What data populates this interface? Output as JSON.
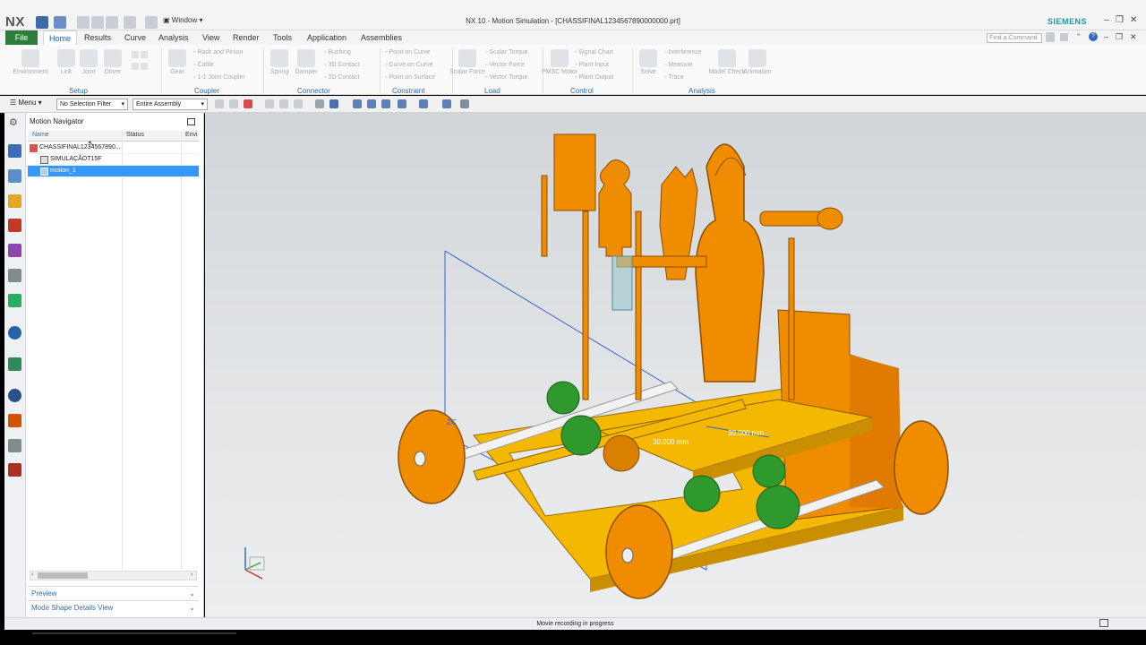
{
  "app": {
    "logo": "NX",
    "window_menu": "Window",
    "title": "NX 10 - Motion Simulation - [CHASSIFINAL1234567890000000.prt]",
    "brand": "SIEMENS",
    "find_command_placeholder": "Find a Command"
  },
  "tabs": [
    "File",
    "Home",
    "Results",
    "Curve",
    "Analysis",
    "View",
    "Render",
    "Tools",
    "Application",
    "Assemblies"
  ],
  "ribbon": {
    "setup": {
      "label": "Setup",
      "items": [
        "Environment",
        "Link",
        "Joint",
        "Driver"
      ]
    },
    "coupler": {
      "label": "Coupler",
      "gear": "Gear",
      "small": [
        "Rack and Pinion",
        "Cable",
        "1-1 Joint Coupler"
      ]
    },
    "connector": {
      "label": "Connector",
      "items": [
        "Spring",
        "Damper"
      ],
      "small": [
        "Bushing",
        "3D Contact",
        "2D Contact"
      ]
    },
    "constraint": {
      "label": "Constraint",
      "small": [
        "Point on Curve",
        "Curve on Curve",
        "Point on Surface"
      ]
    },
    "load": {
      "label": "Load",
      "big": "Scalar Force",
      "small": [
        "Scalar Torque",
        "Vector Force",
        "Vector Torque"
      ]
    },
    "control": {
      "label": "Control",
      "big": "PMSC Motor",
      "small": [
        "Signal Chart",
        "Plant Input",
        "Plant Output"
      ]
    },
    "analysis": {
      "label": "Analysis",
      "items": [
        "Solve"
      ],
      "small": [
        "Interference",
        "Measure",
        "Trace"
      ],
      "model_check": "Model Check",
      "animation": "Animation"
    }
  },
  "toolbar": {
    "menu": "Menu",
    "selection_filter": "No Selection Filter",
    "assembly_scope": "Entire Assembly"
  },
  "navigator": {
    "title": "Motion Navigator",
    "columns": [
      "Name",
      "Status",
      "Envi"
    ],
    "rows": [
      {
        "name": "CHASSIFINAL1234567890..."
      },
      {
        "name": "SIMULAÇÃOT15F"
      },
      {
        "name": "motion_1",
        "selected": true
      }
    ],
    "preview": "Preview",
    "mode_shape": "Mode Shape Details View"
  },
  "viewport": {
    "dim_left": "30.000 mm",
    "dim_right": "30.000 mm",
    "axis_label": "ZC"
  },
  "status": "Movie recording in progress",
  "colors": {
    "part": "#f08c00",
    "base": "#f5b800",
    "gear": "#2e9a2e",
    "accent": "#2f7d3e",
    "selection": "#3399ff"
  }
}
